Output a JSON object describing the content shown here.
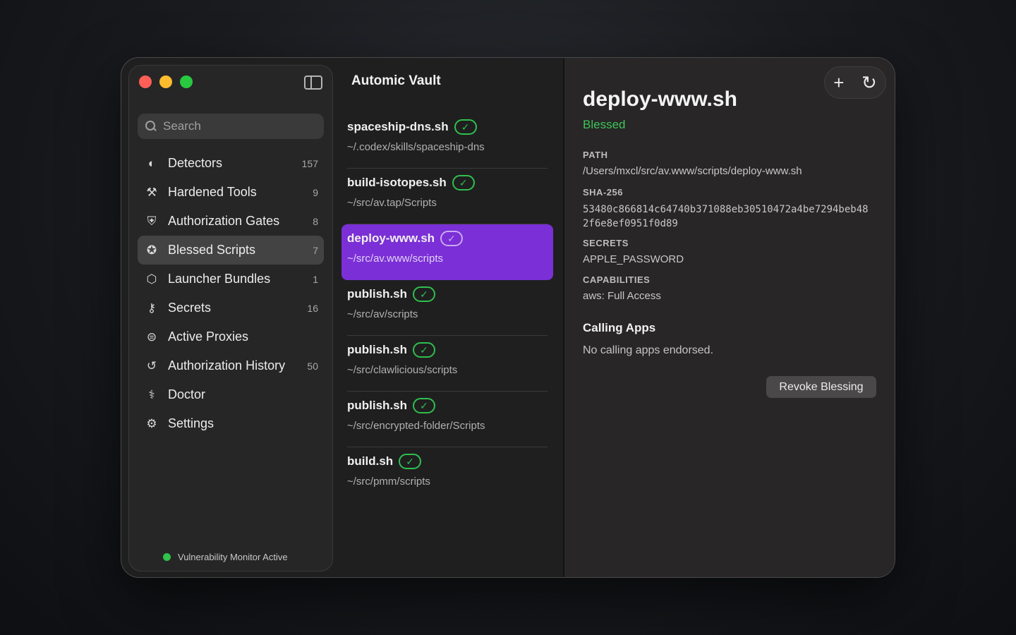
{
  "sidebar": {
    "search_placeholder": "Search",
    "items": [
      {
        "label": "Detectors",
        "count": "157",
        "icon": "detector-icon",
        "glyph": "◐"
      },
      {
        "label": "Hardened Tools",
        "count": "9",
        "icon": "hammer-icon",
        "glyph": "⚒"
      },
      {
        "label": "Authorization Gates",
        "count": "8",
        "icon": "shield-icon",
        "glyph": "⛨"
      },
      {
        "label": "Blessed Scripts",
        "count": "7",
        "icon": "seal-check-icon",
        "glyph": "✪"
      },
      {
        "label": "Launcher Bundles",
        "count": "1",
        "icon": "cube-icon",
        "glyph": "⬡"
      },
      {
        "label": "Secrets",
        "count": "16",
        "icon": "key-icon",
        "glyph": "⚷"
      },
      {
        "label": "Active Proxies",
        "count": "",
        "icon": "proxy-icon",
        "glyph": "⊜"
      },
      {
        "label": "Authorization History",
        "count": "50",
        "icon": "history-icon",
        "glyph": "↺"
      },
      {
        "label": "Doctor",
        "count": "",
        "icon": "stethoscope-icon",
        "glyph": "⚕"
      },
      {
        "label": "Settings",
        "count": "",
        "icon": "gear-icon",
        "glyph": "⚙"
      }
    ],
    "active_index": 3,
    "status_text": "Vulnerability Monitor Active",
    "status_color": "#30c24a"
  },
  "list": {
    "title": "Automic Vault",
    "rows": [
      {
        "name": "spaceship-dns.sh",
        "path": "~/.codex/skills/spaceship-dns"
      },
      {
        "name": "build-isotopes.sh",
        "path": "~/src/av.tap/Scripts"
      },
      {
        "name": "deploy-www.sh",
        "path": "~/src/av.www/scripts"
      },
      {
        "name": "publish.sh",
        "path": "~/src/av/scripts"
      },
      {
        "name": "publish.sh",
        "path": "~/src/clawlicious/scripts"
      },
      {
        "name": "publish.sh",
        "path": "~/src/encrypted-folder/Scripts"
      },
      {
        "name": "build.sh",
        "path": "~/src/pmm/scripts"
      }
    ],
    "selected_index": 2,
    "check_glyph": "✓"
  },
  "detail": {
    "title": "deploy-www.sh",
    "status": "Blessed",
    "path_label": "PATH",
    "path_value": "/Users/mxcl/src/av.www/scripts/deploy-www.sh",
    "sha_label": "SHA-256",
    "sha_value": "53480c866814c64740b371088eb30510472a4be7294beb482f6e8ef0951f0d89",
    "secrets_label": "SECRETS",
    "secrets_value": "APPLE_PASSWORD",
    "capabilities_label": "CAPABILITIES",
    "capabilities_value": "aws: Full Access",
    "calling_title": "Calling Apps",
    "calling_empty": "No calling apps endorsed.",
    "revoke_label": "Revoke Blessing",
    "add_glyph": "+",
    "refresh_glyph": "↻"
  },
  "colors": {
    "accent": "#7b2fd6",
    "blessed_green": "#3cc55a"
  }
}
